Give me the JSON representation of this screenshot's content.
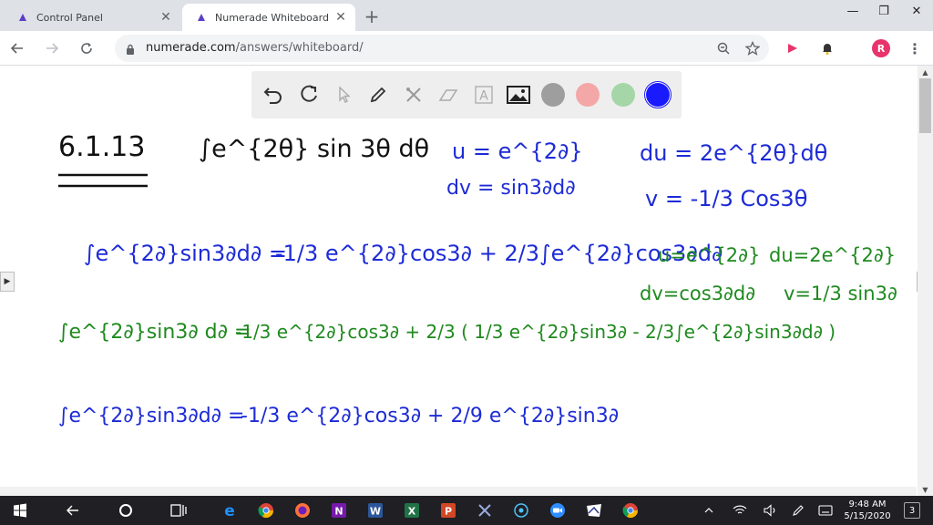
{
  "browser": {
    "tabs": [
      {
        "title": "Control Panel",
        "active": false,
        "icon": "numerade-favicon"
      },
      {
        "title": "Numerade Whiteboard",
        "active": true,
        "icon": "numerade-favicon"
      }
    ],
    "close_glyph": "✕",
    "new_tab_glyph": "+",
    "window_controls": {
      "minimize": "—",
      "restore": "❐",
      "close": "✕"
    },
    "address": {
      "domain": "numerade.com",
      "path": "/answers/whiteboard/"
    },
    "profile_initial": "R",
    "accent": "#1a73e8"
  },
  "whiteboard": {
    "tools": [
      "undo-icon",
      "redo-icon",
      "pointer-icon",
      "pen-icon",
      "tools-icon",
      "eraser-icon",
      "text-icon",
      "image-icon"
    ],
    "text_tool_glyph": "A",
    "colors": [
      "#9e9e9e",
      "#f4a7a7",
      "#a5d6a7",
      "#1a1aff"
    ],
    "selected_color": "#1a1aff",
    "content": {
      "problem_number": "6.1.13",
      "integral": "∫e^{2θ} sin 3θ dθ",
      "sub1_u": "u = e^{2∂}",
      "sub1_dv": "dv = sin3∂d∂",
      "sub1_du": "du = 2e^{2θ}dθ",
      "sub1_v": "v = -1/3 Cos3θ",
      "step1_lhs": "∫e^{2∂}sin3∂d∂ =",
      "step1_rhs": "-1/3 e^{2∂}cos3∂ + 2/3∫e^{2∂}cos3∂d∂",
      "sub2_u": "u=e^{2∂}",
      "sub2_du": "du=2e^{2∂}",
      "sub2_dv": "dv=cos3∂d∂",
      "sub2_v": "v=1/3 sin3∂",
      "step2_lhs": "∫e^{2∂}sin3∂ d∂ =",
      "step2_rhs": "-1/3 e^{2∂}cos3∂ + 2/3 ( 1/3 e^{2∂}sin3∂ - 2/3∫e^{2∂}sin3∂d∂ )",
      "step3_lhs": "∫e^{2∂}sin3∂d∂ =",
      "step3_rhs": "-1/3 e^{2∂}cos3∂ + 2/9 e^{2∂}sin3∂"
    }
  },
  "taskbar": {
    "icons": [
      "windows-start-icon",
      "back-icon",
      "cortana-icon",
      "task-view-icon",
      "edge-icon",
      "chrome-icon",
      "firefox-icon",
      "onenote-icon",
      "word-icon",
      "excel-icon",
      "powerpoint-icon",
      "snip-icon",
      "media-icon",
      "zoom-icon",
      "whiteboard-app-icon",
      "chrome-active-icon"
    ],
    "time": "9:48 AM",
    "date": "5/15/2020",
    "notification_count": "3"
  }
}
